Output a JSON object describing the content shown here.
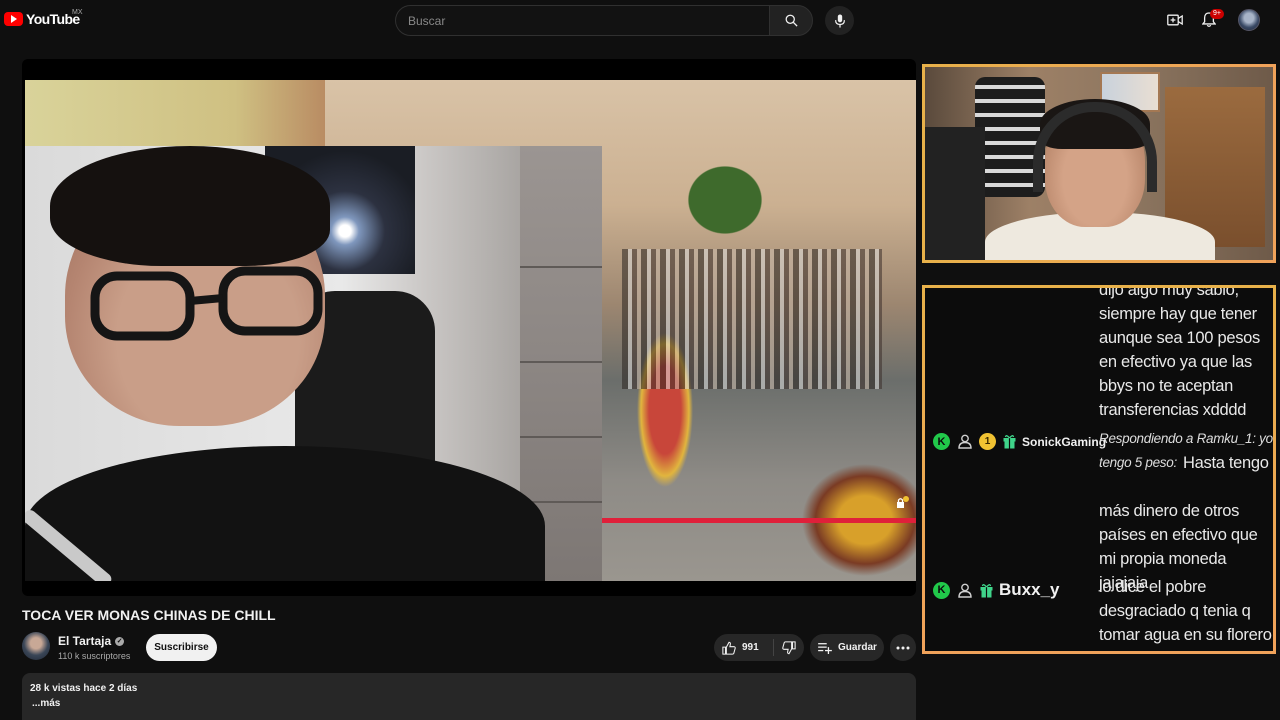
{
  "header": {
    "logo_text": "YouTube",
    "logo_region": "MX",
    "search_placeholder": "Buscar",
    "notification_count": "9+",
    "icons": [
      "search-icon",
      "mic-icon",
      "create-video-icon",
      "bell-icon",
      "avatar"
    ]
  },
  "video": {
    "title": "TOCA VER MONAS CHINAS DE CHILL"
  },
  "channel": {
    "name": "El Tartaja",
    "subscribers": "110 k suscriptores",
    "subscribe_label": "Suscribirse"
  },
  "actions": {
    "likes": "991",
    "save_label": "Guardar"
  },
  "description": {
    "stats": "28 k vistas  hace 2 días",
    "more_label": "...más"
  },
  "chat": {
    "messages": [
      {
        "lines": [
          "dijo algo muy sabio,",
          "siempre hay que tener",
          "aunque sea 100 pesos",
          "en efectivo ya que las",
          "bbys no te aceptan",
          "transferencias xdddd"
        ]
      },
      {
        "user": "SonickGaming",
        "badges": [
          "k-badge",
          "user-icon",
          "sub-badge-1",
          "gift-icon"
        ],
        "sub_level": "1",
        "reply": "Respondiendo a Ramku_1: yo tengo 5 peso:",
        "text_lines": [
          "Hasta tengo",
          "más dinero de otros",
          "países en efectivo que",
          "mi propia moneda",
          "jajajaja"
        ]
      },
      {
        "user": "Buxx_y",
        "badges": [
          "k-badge",
          "user-icon",
          "gift-icon"
        ],
        "lines": [
          "lo dice el pobre",
          "desgraciado q tenia q",
          "tomar agua en su florero"
        ]
      }
    ],
    "k_badge_letter": "K"
  },
  "colors": {
    "background": "#0f0f0f",
    "brand_red": "#ff0000",
    "overlay_border": "#e8b14a",
    "chat_badge_green": "#21c94a",
    "progress_red": "#e0203a"
  }
}
